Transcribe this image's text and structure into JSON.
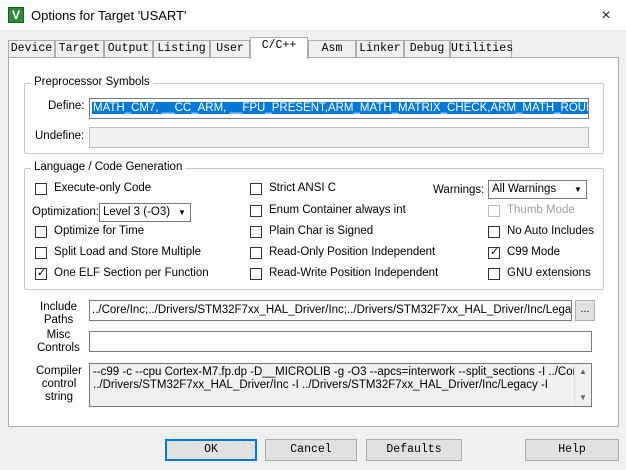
{
  "window": {
    "title": "Options for Target 'USART'"
  },
  "tabs": [
    {
      "label": "Device"
    },
    {
      "label": "Target"
    },
    {
      "label": "Output"
    },
    {
      "label": "Listing"
    },
    {
      "label": "User"
    },
    {
      "label": "C/C++"
    },
    {
      "label": "Asm"
    },
    {
      "label": "Linker"
    },
    {
      "label": "Debug"
    },
    {
      "label": "Utilities"
    }
  ],
  "preprocessor": {
    "title": "Preprocessor Symbols",
    "define_label": "Define:",
    "define_value": "MATH_CM7, __CC_ARM, __FPU_PRESENT,ARM_MATH_MATRIX_CHECK,ARM_MATH_ROUNDING",
    "undefine_label": "Undefine:",
    "undefine_value": ""
  },
  "language": {
    "title": "Language / Code Generation",
    "execute_only": {
      "label": "Execute-only Code",
      "checked": false
    },
    "optimization_label": "Optimization:",
    "optimization_value": "Level 3 (-O3)",
    "optimize_time": {
      "label": "Optimize for Time",
      "checked": false
    },
    "split_load": {
      "label": "Split Load and Store Multiple",
      "checked": false
    },
    "one_elf": {
      "label": "One ELF Section per Function",
      "checked": true
    },
    "strict_ansi": {
      "label": "Strict ANSI C",
      "checked": false
    },
    "enum_container": {
      "label": "Enum Container always int",
      "checked": false
    },
    "plain_char": {
      "label": "Plain Char is Signed",
      "checked": false
    },
    "ro_pos": {
      "label": "Read-Only Position Independent",
      "checked": false
    },
    "rw_pos": {
      "label": "Read-Write Position Independent",
      "checked": false
    },
    "warnings_label": "Warnings:",
    "warnings_value": "All Warnings",
    "thumb_mode": {
      "label": "Thumb Mode",
      "checked": false
    },
    "no_auto_includes": {
      "label": "No Auto Includes",
      "checked": false
    },
    "c99_mode": {
      "label": "C99 Mode",
      "checked": true
    },
    "gnu_ext": {
      "label": "GNU extensions",
      "checked": false
    }
  },
  "include": {
    "label_line1": "Include",
    "label_line2": "Paths",
    "value": "../Core/Inc;../Drivers/STM32F7xx_HAL_Driver/Inc;../Drivers/STM32F7xx_HAL_Driver/Inc/Legacy;",
    "browse_label": "..."
  },
  "misc": {
    "label_line1": "Misc",
    "label_line2": "Controls",
    "value": ""
  },
  "compiler": {
    "label_line1": "Compiler",
    "label_line2": "control",
    "label_line3": "string",
    "line1": "--c99 -c --cpu Cortex-M7.fp.dp -D__MICROLIB -g -O3 --apcs=interwork --split_sections -I ../Core/Inc -I",
    "line2": "../Drivers/STM32F7xx_HAL_Driver/Inc -I ../Drivers/STM32F7xx_HAL_Driver/Inc/Legacy -I"
  },
  "buttons": {
    "ok": "OK",
    "cancel": "Cancel",
    "defaults": "Defaults",
    "help": "Help"
  },
  "icons": {
    "close": "×",
    "dropdown": "▼",
    "scroll_up": "▲",
    "scroll_down": "▼",
    "app_icon": "keil-uvision-icon"
  },
  "colors": {
    "selection": "#0078d7",
    "default_button_border": "#0078d7"
  }
}
